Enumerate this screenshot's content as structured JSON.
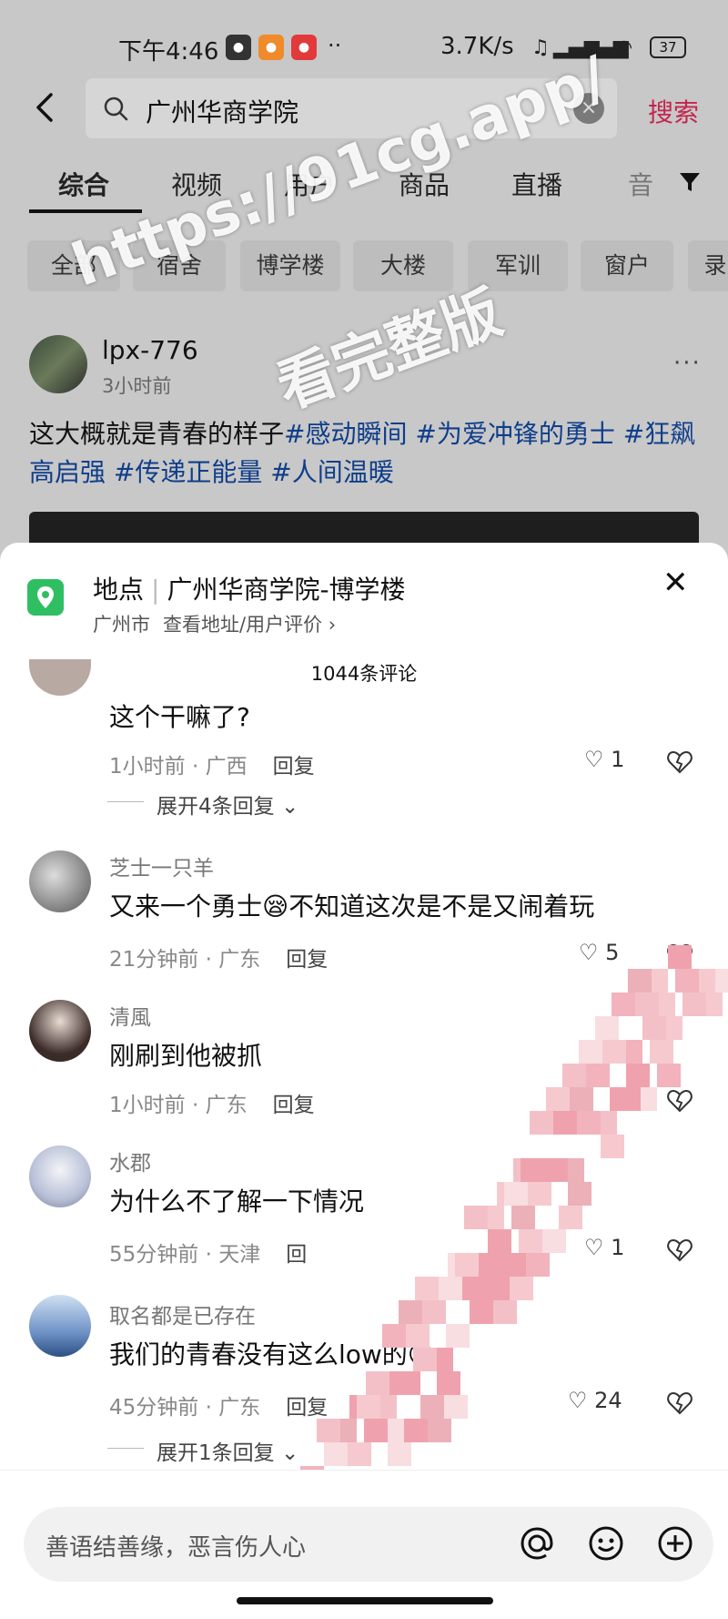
{
  "status": {
    "time": "下午4:46",
    "speed": "3.7K/s",
    "battery": "37"
  },
  "search": {
    "query": "广州华商学院",
    "button": "搜索"
  },
  "tabs": [
    "综合",
    "视频",
    "用户",
    "商品",
    "直播",
    "音"
  ],
  "chips": [
    "全部",
    "宿舍",
    "博学楼",
    "大楼",
    "军训",
    "窗户",
    "录"
  ],
  "post": {
    "user": "lpx-776",
    "time": "3小时前",
    "text": "这大概就是青春的样子",
    "tags": [
      "#感动瞬间",
      "#为爱冲锋的勇士",
      "#狂飙高启强",
      "#传递正能量",
      "#人间温暖"
    ]
  },
  "watermark": {
    "line1": "https://91cg.app/",
    "line2": "看完整版"
  },
  "location": {
    "label": "地点",
    "place": "广州华商学院-博学楼",
    "city": "广州市",
    "link": "查看地址/用户评价 ›"
  },
  "comment_count": "1044条评论",
  "comments": [
    {
      "name": "",
      "text": "这个干嘛了?",
      "time": "1小时前 · 广西",
      "reply": "回复",
      "likes": "1",
      "expand": "展开4条回复"
    },
    {
      "name": "芝士一只羊",
      "text": "又来一个勇士😪不知道这次是不是又闹着玩",
      "time": "21分钟前 · 广东",
      "reply": "回复",
      "likes": "5",
      "expand": ""
    },
    {
      "name": "清風",
      "text": "刚刷到他被抓",
      "time": "1小时前 · 广东",
      "reply": "回复",
      "likes": "",
      "expand": ""
    },
    {
      "name": "水郡",
      "text": "为什么不了解一下情况",
      "time": "55分钟前 · 天津",
      "reply": "回",
      "likes": "1",
      "expand": ""
    },
    {
      "name": "取名都是已存在",
      "text": "我们的青春没有这么low的😲",
      "time": "45分钟前 · 广东",
      "reply": "回复",
      "likes": "24",
      "expand": "展开1条回复"
    }
  ],
  "input": {
    "placeholder": "善语结善缘，恶言伤人心"
  }
}
